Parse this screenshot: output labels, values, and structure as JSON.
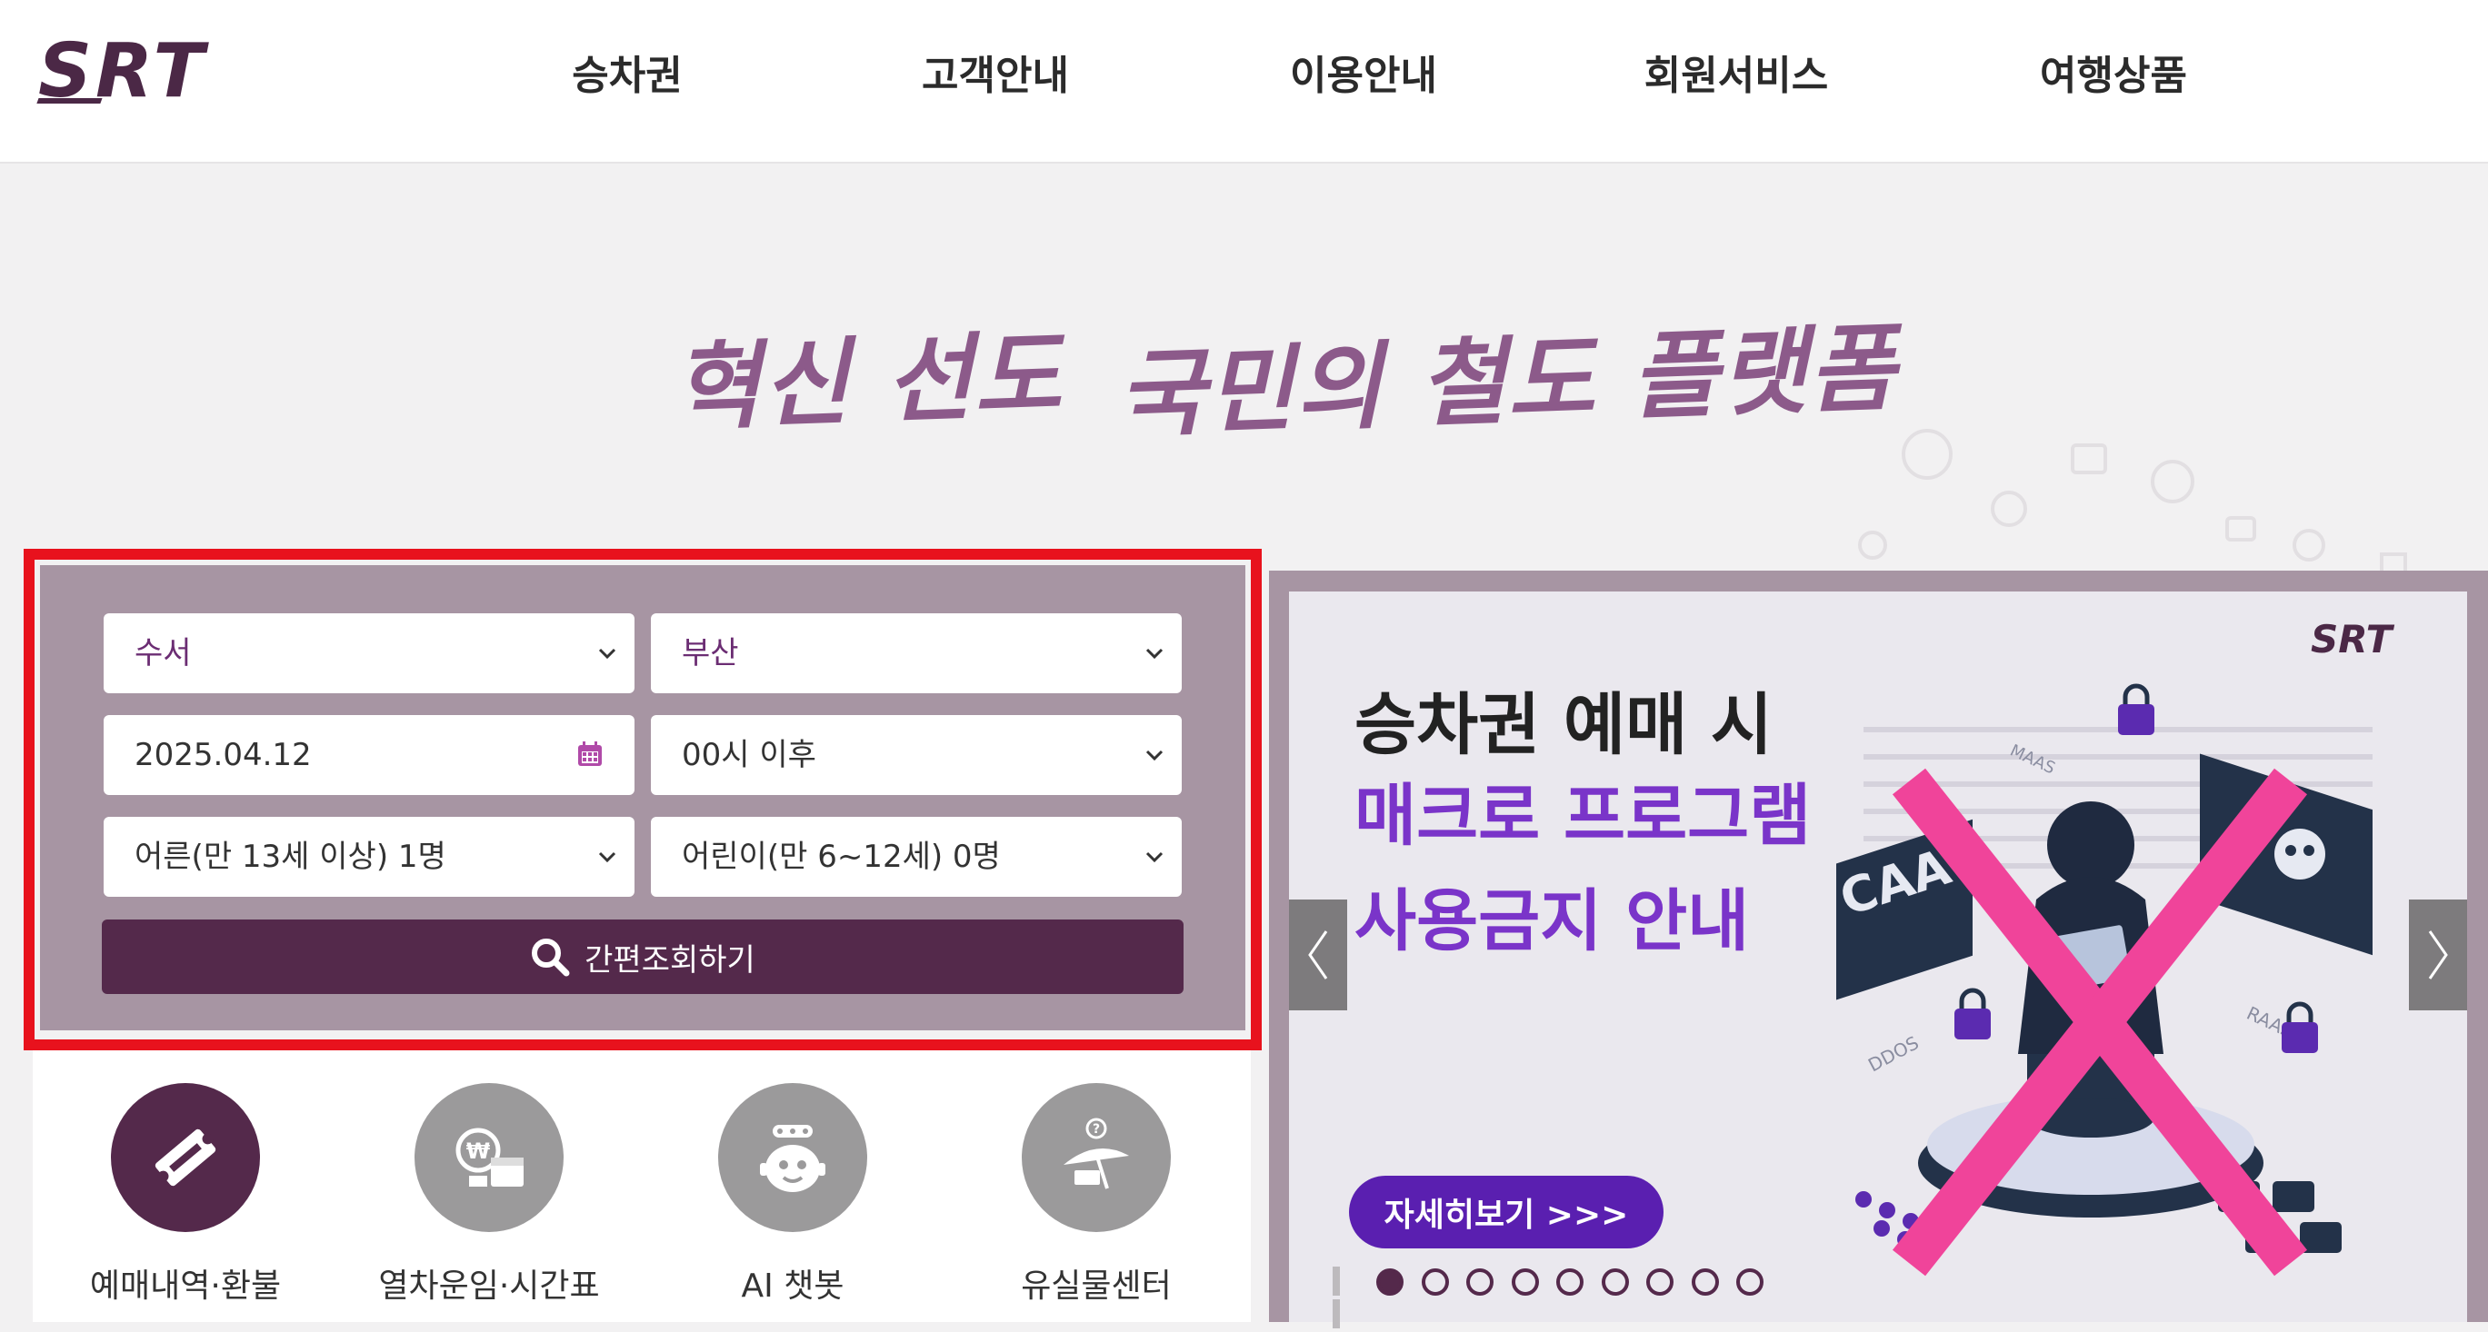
{
  "header": {
    "logo_text": "SRT",
    "nav": [
      "승차권",
      "고객안내",
      "이용안내",
      "회원서비스",
      "여행상품"
    ]
  },
  "slogan": {
    "part1": "혁신 선도",
    "part2": "국민의 철도 플랫폼"
  },
  "booking": {
    "departure": "수서",
    "arrival": "부산",
    "date": "2025.04.12",
    "time": "00시 이후",
    "adult": "어른(만 13세 이상) 1명",
    "child": "어린이(만 6~12세) 0명",
    "search_label": "간편조회하기"
  },
  "quick_menu": [
    {
      "label": "예매내역·환불",
      "icon": "ticket-icon"
    },
    {
      "label": "열차운임·시간표",
      "icon": "fare-calendar-icon"
    },
    {
      "label": "AI 챗봇",
      "icon": "robot-icon"
    },
    {
      "label": "유실물센터",
      "icon": "umbrella-icon"
    }
  ],
  "banner": {
    "logo_text": "SRT",
    "line1": "승차권 예매 시",
    "line2": "매크로 프로그램",
    "line3": "사용금지 안내",
    "detail_label": "자세히보기 >>>",
    "art_labels": [
      "CAA",
      "MAAS",
      "DDOS",
      "RAAS"
    ],
    "slide_count": 9,
    "active_slide": 1
  },
  "colors": {
    "brand_purple": "#54294b",
    "panel_bg": "#a795a3",
    "highlight_red": "#e8121d",
    "banner_accent": "#7a34c9",
    "cross_pink": "#f0449a"
  }
}
